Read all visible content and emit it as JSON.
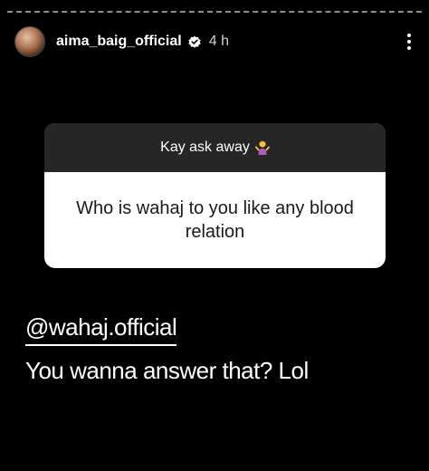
{
  "story": {
    "username": "aima_baig_official",
    "timestamp": "4 h",
    "verified": true,
    "more_icon": "more-vertical-icon"
  },
  "question_sticker": {
    "prompt": "Kay ask away",
    "prompt_emoji": "person-shrugging-emoji",
    "question": "Who is wahaj to you like any blood relation"
  },
  "reply": {
    "mention": "@wahaj.official",
    "text": "You wanna answer that? Lol"
  },
  "colors": {
    "background": "#000000",
    "card_header": "#262626",
    "card_body": "#ffffff",
    "text": "#ffffff"
  }
}
